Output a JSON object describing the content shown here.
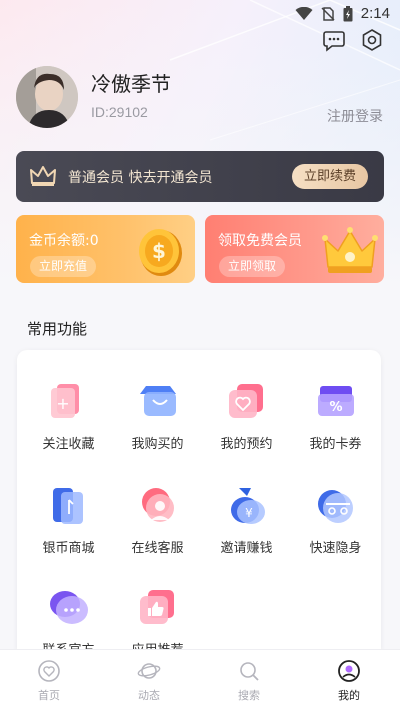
{
  "status_bar": {
    "time": "2:14"
  },
  "profile": {
    "name": "冷傲季节",
    "id_text": "ID:29102",
    "register_link": "注册登录"
  },
  "vip": {
    "text": "普通会员  快去开通会员",
    "button": "立即续费"
  },
  "cards": {
    "coin": {
      "title": "金币余额:0",
      "button": "立即充值"
    },
    "free": {
      "title": "领取免费会员",
      "button": "立即领取"
    }
  },
  "functions": {
    "title": "常用功能",
    "items": [
      {
        "label": "关注收藏",
        "icon": "collect-icon"
      },
      {
        "label": "我购买的",
        "icon": "shopping-bag-icon"
      },
      {
        "label": "我的预约",
        "icon": "reservation-icon"
      },
      {
        "label": "我的卡券",
        "icon": "coupon-icon"
      },
      {
        "label": "银币商城",
        "icon": "mall-icon"
      },
      {
        "label": "在线客服",
        "icon": "customer-service-icon"
      },
      {
        "label": "邀请赚钱",
        "icon": "money-bag-icon"
      },
      {
        "label": "快速隐身",
        "icon": "incognito-icon"
      },
      {
        "label": "联系官方",
        "icon": "chat-bubble-icon"
      },
      {
        "label": "应用推荐",
        "icon": "thumbs-up-icon"
      }
    ]
  },
  "nav": {
    "items": [
      {
        "label": "首页",
        "icon": "home-heart-icon"
      },
      {
        "label": "动态",
        "icon": "planet-icon"
      },
      {
        "label": "搜索",
        "icon": "search-icon"
      },
      {
        "label": "我的",
        "icon": "profile-icon"
      }
    ],
    "active_index": 3
  },
  "colors": {
    "coin_card": "#ffb24b",
    "free_card": "#ff7f72",
    "vip_bar": "#43434e",
    "vip_gold": "#f5dfc4"
  }
}
